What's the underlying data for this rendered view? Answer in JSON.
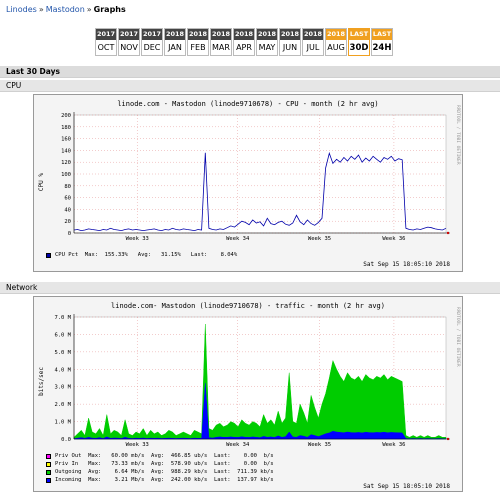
{
  "breadcrumb": {
    "item1": "Linodes",
    "item2": "Mastodon",
    "current": "Graphs",
    "sep": "»"
  },
  "tabs": [
    {
      "year": "2017",
      "label": "OCT"
    },
    {
      "year": "2017",
      "label": "NOV"
    },
    {
      "year": "2017",
      "label": "DEC"
    },
    {
      "year": "2018",
      "label": "JAN"
    },
    {
      "year": "2018",
      "label": "FEB"
    },
    {
      "year": "2018",
      "label": "MAR"
    },
    {
      "year": "2018",
      "label": "APR"
    },
    {
      "year": "2018",
      "label": "MAY"
    },
    {
      "year": "2018",
      "label": "JUN"
    },
    {
      "year": "2018",
      "label": "JUL"
    },
    {
      "year": "2018",
      "label": "AUG"
    },
    {
      "year": "LAST",
      "label": "30D"
    },
    {
      "year": "LAST",
      "label": "24H"
    }
  ],
  "section": {
    "title": "Last 30 Days",
    "cpu": "CPU",
    "network": "Network"
  },
  "cpu_graph": {
    "title": "linode.com - Mastodon (linode9710678) - CPU - month (2 hr avg)",
    "side": "RRDTOOL / TOBI OETIKER",
    "ylabel": "CPU %",
    "legend": {
      "name": "CPU Pct",
      "text": "  Max:  155.33%   Avg:   31.15%   Last:    8.04%",
      "color": "#0000aa"
    },
    "timestamp": "Sat Sep 15 18:05:10 2018"
  },
  "net_graph": {
    "title": "linode.com- Mastodon (linode9710678) - traffic - month (2 hr avg)",
    "side": "RRDTOOL / TOBI OETIKER",
    "ylabel": "bits/sec",
    "legend": [
      {
        "name": "Priv Out",
        "text": "  Max:   60.00 mb/s  Avg:  466.85 ub/s  Last:    0.00  b/s",
        "color": "#ff00ff"
      },
      {
        "name": "Priv In",
        "text": "   Max:   73.33 mb/s  Avg:  578.90 ub/s  Last:    0.00  b/s",
        "color": "#ffff00"
      },
      {
        "name": "Outgoing",
        "text": "  Avg:    6.64 Mb/s  Avg:  988.29 kb/s  Last:  711.39 kb/s",
        "color": "#00cc00"
      },
      {
        "name": "Incoming",
        "text": "  Max:    3.21 Mb/s  Avg:  242.00 kb/s  Last:  137.97 kb/s",
        "color": "#0000ff"
      }
    ],
    "timestamp": "Sat Sep 15 18:05:10 2018"
  },
  "chart_data": [
    {
      "type": "line",
      "title": "linode.com - Mastodon (linode9710678) - CPU - month (2 hr avg)",
      "ylabel": "CPU %",
      "ylim": [
        0,
        200
      ],
      "yticks": [
        0,
        20,
        40,
        60,
        80,
        100,
        120,
        140,
        160,
        180,
        200
      ],
      "xticks": [
        "Week 33",
        "Week 34",
        "Week 35",
        "Week 36"
      ],
      "series": [
        {
          "name": "CPU Pct",
          "color": "#0000aa",
          "values": [
            5,
            6,
            4,
            5,
            7,
            6,
            5,
            4,
            6,
            5,
            8,
            6,
            5,
            4,
            6,
            7,
            5,
            6,
            5,
            4,
            5,
            6,
            7,
            5,
            4,
            6,
            5,
            8,
            6,
            5,
            7,
            6,
            5,
            4,
            6,
            5,
            136,
            8,
            6,
            5,
            7,
            6,
            9,
            12,
            10,
            15,
            20,
            18,
            14,
            22,
            17,
            19,
            12,
            25,
            16,
            14,
            18,
            20,
            15,
            13,
            17,
            30,
            19,
            14,
            22,
            16,
            13,
            18,
            25,
            110,
            135,
            118,
            125,
            120,
            128,
            122,
            130,
            125,
            132,
            120,
            127,
            122,
            130,
            125,
            120,
            128,
            125,
            130,
            122,
            126,
            124,
            8,
            6,
            5,
            7,
            6,
            8,
            10,
            9,
            7,
            6,
            5,
            8
          ]
        }
      ]
    },
    {
      "type": "area",
      "title": "linode.com- Mastodon (linode9710678) - traffic - month (2 hr avg)",
      "ylabel": "bits/sec",
      "ylim": [
        0,
        7000000
      ],
      "yticks": [
        "0.0",
        "1.0 M",
        "2.0 M",
        "3.0 M",
        "4.0 M",
        "5.0 M",
        "6.0 M",
        "7.0 M"
      ],
      "xticks": [
        "Week 33",
        "Week 34",
        "Week 35",
        "Week 36"
      ],
      "series": [
        {
          "name": "Outgoing",
          "color": "#00cc00",
          "values": [
            0.1,
            0.3,
            0.5,
            0.2,
            1.2,
            0.4,
            0.3,
            0.6,
            0.2,
            1.4,
            0.3,
            0.5,
            0.4,
            0.2,
            1.1,
            0.3,
            0.2,
            0.4,
            0.3,
            0.6,
            0.2,
            0.5,
            0.3,
            0.4,
            0.2,
            0.3,
            0.5,
            0.4,
            0.2,
            0.3,
            0.4,
            0.3,
            0.2,
            0.5,
            0.4,
            0.3,
            6.6,
            0.6,
            0.5,
            0.8,
            0.9,
            0.7,
            0.8,
            1.0,
            0.9,
            0.7,
            1.1,
            0.9,
            0.8,
            1.0,
            0.9,
            0.7,
            1.4,
            0.9,
            1.1,
            0.8,
            1.6,
            0.9,
            1.2,
            3.8,
            1.0,
            0.9,
            2.0,
            1.5,
            0.9,
            2.5,
            1.8,
            1.2,
            2.0,
            2.6,
            3.5,
            4.5,
            4.0,
            3.6,
            3.3,
            3.8,
            3.5,
            3.4,
            3.6,
            3.3,
            3.7,
            3.5,
            3.4,
            3.6,
            3.5,
            3.7,
            3.4,
            3.6,
            3.5,
            3.4,
            3.3,
            0.2,
            0.1,
            0.2,
            0.1,
            0.2,
            0.1,
            0.2,
            0.1,
            0.1,
            0.2,
            0.1,
            0.1
          ]
        },
        {
          "name": "Incoming",
          "color": "#0000ff",
          "values": [
            0.02,
            0.05,
            0.08,
            0.04,
            0.1,
            0.05,
            0.04,
            0.08,
            0.03,
            0.12,
            0.04,
            0.06,
            0.05,
            0.03,
            0.1,
            0.04,
            0.03,
            0.05,
            0.04,
            0.06,
            0.03,
            0.05,
            0.04,
            0.05,
            0.03,
            0.04,
            0.05,
            0.04,
            0.03,
            0.04,
            0.05,
            0.04,
            0.03,
            0.05,
            0.04,
            0.04,
            3.2,
            0.08,
            0.06,
            0.1,
            0.12,
            0.1,
            0.1,
            0.12,
            0.1,
            0.09,
            0.13,
            0.1,
            0.09,
            0.12,
            0.1,
            0.08,
            0.15,
            0.1,
            0.12,
            0.09,
            0.18,
            0.1,
            0.13,
            0.4,
            0.12,
            0.1,
            0.2,
            0.16,
            0.1,
            0.25,
            0.2,
            0.14,
            0.22,
            0.3,
            0.35,
            0.45,
            0.4,
            0.38,
            0.36,
            0.4,
            0.37,
            0.36,
            0.38,
            0.35,
            0.39,
            0.37,
            0.36,
            0.38,
            0.37,
            0.39,
            0.36,
            0.38,
            0.37,
            0.36,
            0.35,
            0.03,
            0.02,
            0.03,
            0.02,
            0.03,
            0.02,
            0.03,
            0.02,
            0.02,
            0.03,
            0.02,
            0.02
          ]
        }
      ]
    }
  ]
}
